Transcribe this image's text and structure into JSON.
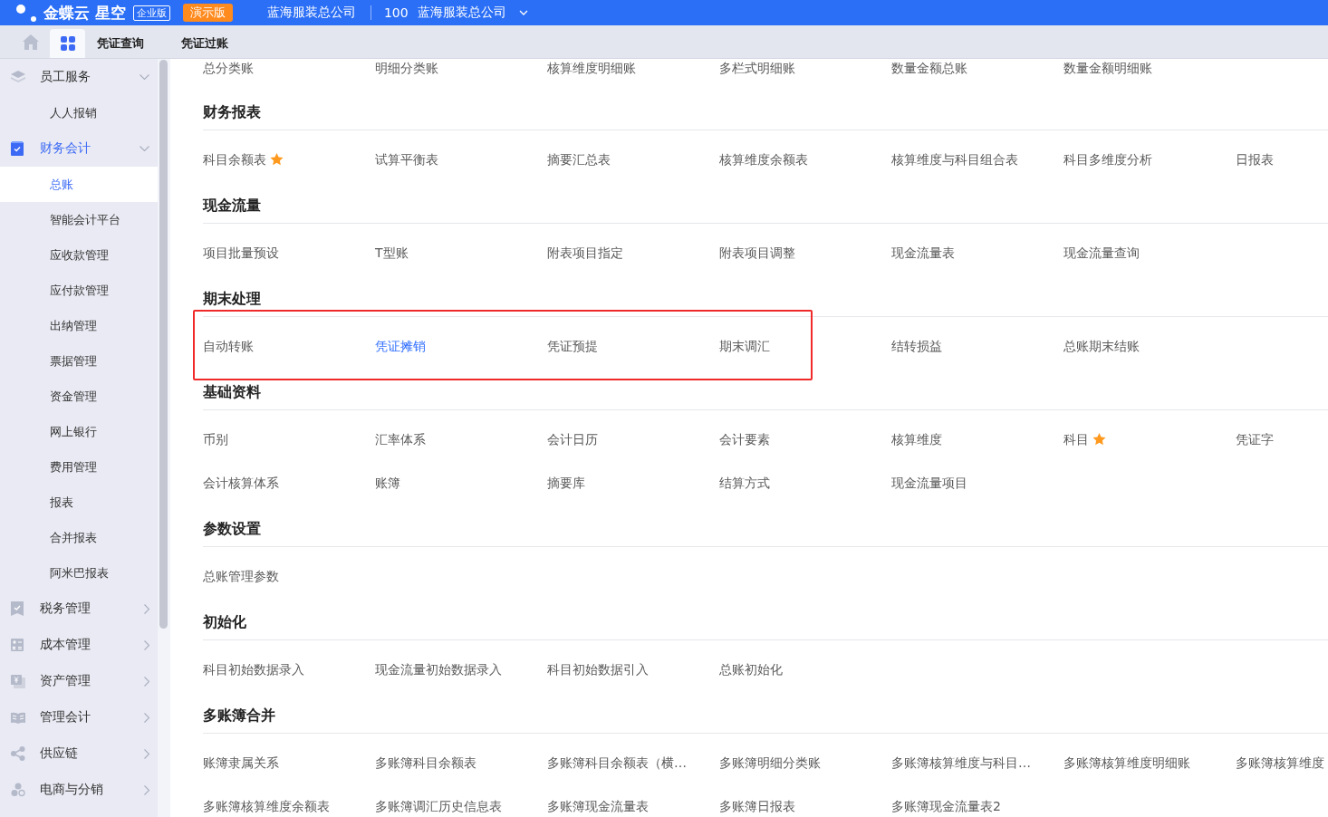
{
  "top_bar": {
    "product": "金蝶云 星空",
    "edition_badge": "企业版",
    "demo_badge": "演示版",
    "company": "蓝海服装总公司",
    "org_code": "100",
    "org_name": "蓝海服装总公司"
  },
  "tabs": [
    {
      "kind": "grid",
      "selected": true
    },
    {
      "kind": "text",
      "label": "凭证查询",
      "selected": false
    },
    {
      "kind": "text",
      "label": "凭证过账",
      "selected": false
    }
  ],
  "sidebar": {
    "items": [
      {
        "label": "员工服务",
        "expanded": true,
        "selected": false,
        "children": [
          {
            "label": "人人报销",
            "selected": false
          }
        ]
      },
      {
        "label": "财务会计",
        "expanded": true,
        "selected": true,
        "children": [
          {
            "label": "总账",
            "selected": true
          },
          {
            "label": "智能会计平台",
            "selected": false
          },
          {
            "label": "应收款管理",
            "selected": false
          },
          {
            "label": "应付款管理",
            "selected": false
          },
          {
            "label": "出纳管理",
            "selected": false
          },
          {
            "label": "票据管理",
            "selected": false
          },
          {
            "label": "资金管理",
            "selected": false
          },
          {
            "label": "网上银行",
            "selected": false
          },
          {
            "label": "费用管理",
            "selected": false
          },
          {
            "label": "报表",
            "selected": false
          },
          {
            "label": "合并报表",
            "selected": false
          },
          {
            "label": "阿米巴报表",
            "selected": false
          }
        ]
      },
      {
        "label": "税务管理",
        "expanded": false,
        "selected": false
      },
      {
        "label": "成本管理",
        "expanded": false,
        "selected": false
      },
      {
        "label": "资产管理",
        "expanded": false,
        "selected": false
      },
      {
        "label": "管理会计",
        "expanded": false,
        "selected": false
      },
      {
        "label": "供应链",
        "expanded": false,
        "selected": false
      },
      {
        "label": "电商与分销",
        "expanded": false,
        "selected": false
      }
    ]
  },
  "content": {
    "top_row": [
      "总分类账",
      "明细分类账",
      "核算维度明细账",
      "多栏式明细账",
      "数量金额总账",
      "数量金额明细账"
    ],
    "sections": [
      {
        "title": "财务报表",
        "items": [
          {
            "label": "科目余额表",
            "selected": false,
            "starred": true
          },
          {
            "label": "试算平衡表",
            "selected": false,
            "starred": false
          },
          {
            "label": "摘要汇总表",
            "selected": false,
            "starred": false
          },
          {
            "label": "核算维度余额表",
            "selected": false,
            "starred": false
          },
          {
            "label": "核算维度与科目组合表",
            "selected": false,
            "starred": false
          },
          {
            "label": "科目多维度分析",
            "selected": false,
            "starred": false
          },
          {
            "label": "日报表",
            "selected": false,
            "starred": false
          }
        ]
      },
      {
        "title": "现金流量",
        "items": [
          {
            "label": "项目批量预设",
            "selected": false,
            "starred": false
          },
          {
            "label": "T型账",
            "selected": false,
            "starred": false
          },
          {
            "label": "附表项目指定",
            "selected": false,
            "starred": false
          },
          {
            "label": "附表项目调整",
            "selected": false,
            "starred": false
          },
          {
            "label": "现金流量表",
            "selected": false,
            "starred": false
          },
          {
            "label": "现金流量查询",
            "selected": false,
            "starred": false
          }
        ]
      },
      {
        "title": "期末处理",
        "items": [
          {
            "label": "自动转账",
            "selected": false,
            "starred": false,
            "boxed": true
          },
          {
            "label": "凭证摊销",
            "selected": true,
            "starred": false,
            "boxed": true
          },
          {
            "label": "凭证预提",
            "selected": false,
            "starred": false,
            "boxed": true
          },
          {
            "label": "期末调汇",
            "selected": false,
            "starred": false,
            "boxed": true
          },
          {
            "label": "结转损益",
            "selected": false,
            "starred": false,
            "boxed": false
          },
          {
            "label": "总账期末结账",
            "selected": false,
            "starred": false,
            "boxed": false
          }
        ]
      },
      {
        "title": "基础资料",
        "items": [
          {
            "label": "币别",
            "selected": false,
            "starred": false
          },
          {
            "label": "汇率体系",
            "selected": false,
            "starred": false
          },
          {
            "label": "会计日历",
            "selected": false,
            "starred": false
          },
          {
            "label": "会计要素",
            "selected": false,
            "starred": false
          },
          {
            "label": "核算维度",
            "selected": false,
            "starred": false
          },
          {
            "label": "科目",
            "selected": false,
            "starred": true
          },
          {
            "label": "凭证字",
            "selected": false,
            "starred": false
          },
          {
            "label": "会计核算体系",
            "selected": false,
            "starred": false
          },
          {
            "label": "账簿",
            "selected": false,
            "starred": false
          },
          {
            "label": "摘要库",
            "selected": false,
            "starred": false
          },
          {
            "label": "结算方式",
            "selected": false,
            "starred": false
          },
          {
            "label": "现金流量项目",
            "selected": false,
            "starred": false
          }
        ]
      },
      {
        "title": "参数设置",
        "items": [
          {
            "label": "总账管理参数",
            "selected": false,
            "starred": false
          }
        ]
      },
      {
        "title": "初始化",
        "items": [
          {
            "label": "科目初始数据录入",
            "selected": false,
            "starred": false
          },
          {
            "label": "现金流量初始数据录入",
            "selected": false,
            "starred": false
          },
          {
            "label": "科目初始数据引入",
            "selected": false,
            "starred": false
          },
          {
            "label": "总账初始化",
            "selected": false,
            "starred": false
          }
        ]
      },
      {
        "title": "多账簿合并",
        "items": [
          {
            "label": "账簿隶属关系",
            "selected": false,
            "starred": false
          },
          {
            "label": "多账簿科目余额表",
            "selected": false,
            "starred": false
          },
          {
            "label": "多账簿科目余额表（横…",
            "selected": false,
            "starred": false
          },
          {
            "label": "多账簿明细分类账",
            "selected": false,
            "starred": false
          },
          {
            "label": "多账簿核算维度与科目…",
            "selected": false,
            "starred": false
          },
          {
            "label": "多账簿核算维度明细账",
            "selected": false,
            "starred": false
          },
          {
            "label": "多账簿核算维度",
            "selected": false,
            "starred": false
          },
          {
            "label": "多账簿核算维度余额表",
            "selected": false,
            "starred": false
          },
          {
            "label": "多账簿调汇历史信息表",
            "selected": false,
            "starred": false
          },
          {
            "label": "多账簿现金流量表",
            "selected": false,
            "starred": false
          },
          {
            "label": "多账簿日报表",
            "selected": false,
            "starred": false
          },
          {
            "label": "多账簿现金流量表2",
            "selected": false,
            "starred": false
          }
        ]
      }
    ]
  }
}
